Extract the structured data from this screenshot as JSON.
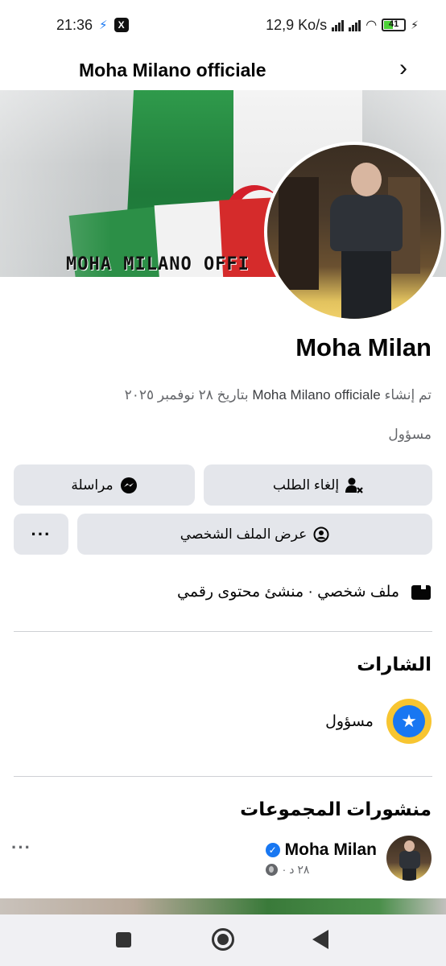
{
  "status_bar": {
    "time": "21:36",
    "network_speed": "12,9 Ko/s",
    "battery": "41",
    "icons": [
      "messenger-bolt-icon",
      "x-app-icon",
      "signal-icon",
      "signal-icon",
      "wifi-icon",
      "battery-icon",
      "charging-icon"
    ]
  },
  "header": {
    "title": "Moha Milano officiale",
    "next_icon": "chevron-right-icon"
  },
  "cover": {
    "text": "MOHA MILANO OFFI"
  },
  "profile": {
    "name": "Moha Milan",
    "created_prefix": "تم إنشاء",
    "created_page": "Moha Milano officiale",
    "created_suffix": "بتاريخ ٢٨ نوفمبر ٢٠٢٥",
    "role": "مسؤول"
  },
  "buttons": {
    "cancel_request": "إلغاء الطلب",
    "message": "مراسلة",
    "view_profile": "عرض الملف الشخصي",
    "more": "···"
  },
  "intro": {
    "text": "ملف شخصي · منشئ محتوى رقمي"
  },
  "badges": {
    "title": "الشارات",
    "items": [
      {
        "label": "مسؤول",
        "icon": "star-badge-icon"
      }
    ]
  },
  "group_posts": {
    "title": "منشورات المجموعات",
    "author": "Moha Milan",
    "time": "٢٨ د ·",
    "more": "···"
  },
  "nav_bar": {
    "items": [
      "recents-square-icon",
      "home-circle-icon",
      "back-triangle-icon"
    ]
  },
  "colors": {
    "accent": "#1877f2",
    "button_bg": "#e4e6eb",
    "secondary_text": "#65676b",
    "badge_gold": "#f7c531"
  }
}
